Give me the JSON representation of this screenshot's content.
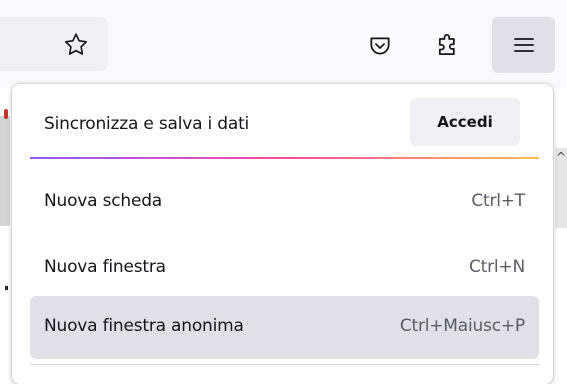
{
  "toolbar": {
    "icons": {
      "bookmark": "star-icon",
      "pocket": "pocket-icon",
      "extensions": "puzzle-extensions-icon",
      "menu": "hamburger-menu-icon"
    }
  },
  "panel": {
    "sync": {
      "label": "Sincronizza e salva i dati",
      "button_label": "Accedi"
    },
    "items": [
      {
        "label": "Nuova scheda",
        "shortcut": "Ctrl+T"
      },
      {
        "label": "Nuova finestra",
        "shortcut": "Ctrl+N"
      },
      {
        "label": "Nuova finestra anonima",
        "shortcut": "Ctrl+Maiusc+P"
      }
    ]
  },
  "colors": {
    "accent_gradient": [
      "#9059ff",
      "#ff4aa2",
      "#ffbd4f"
    ],
    "hover_bg": "#e0e0e6",
    "button_bg": "#f0f0f4"
  }
}
